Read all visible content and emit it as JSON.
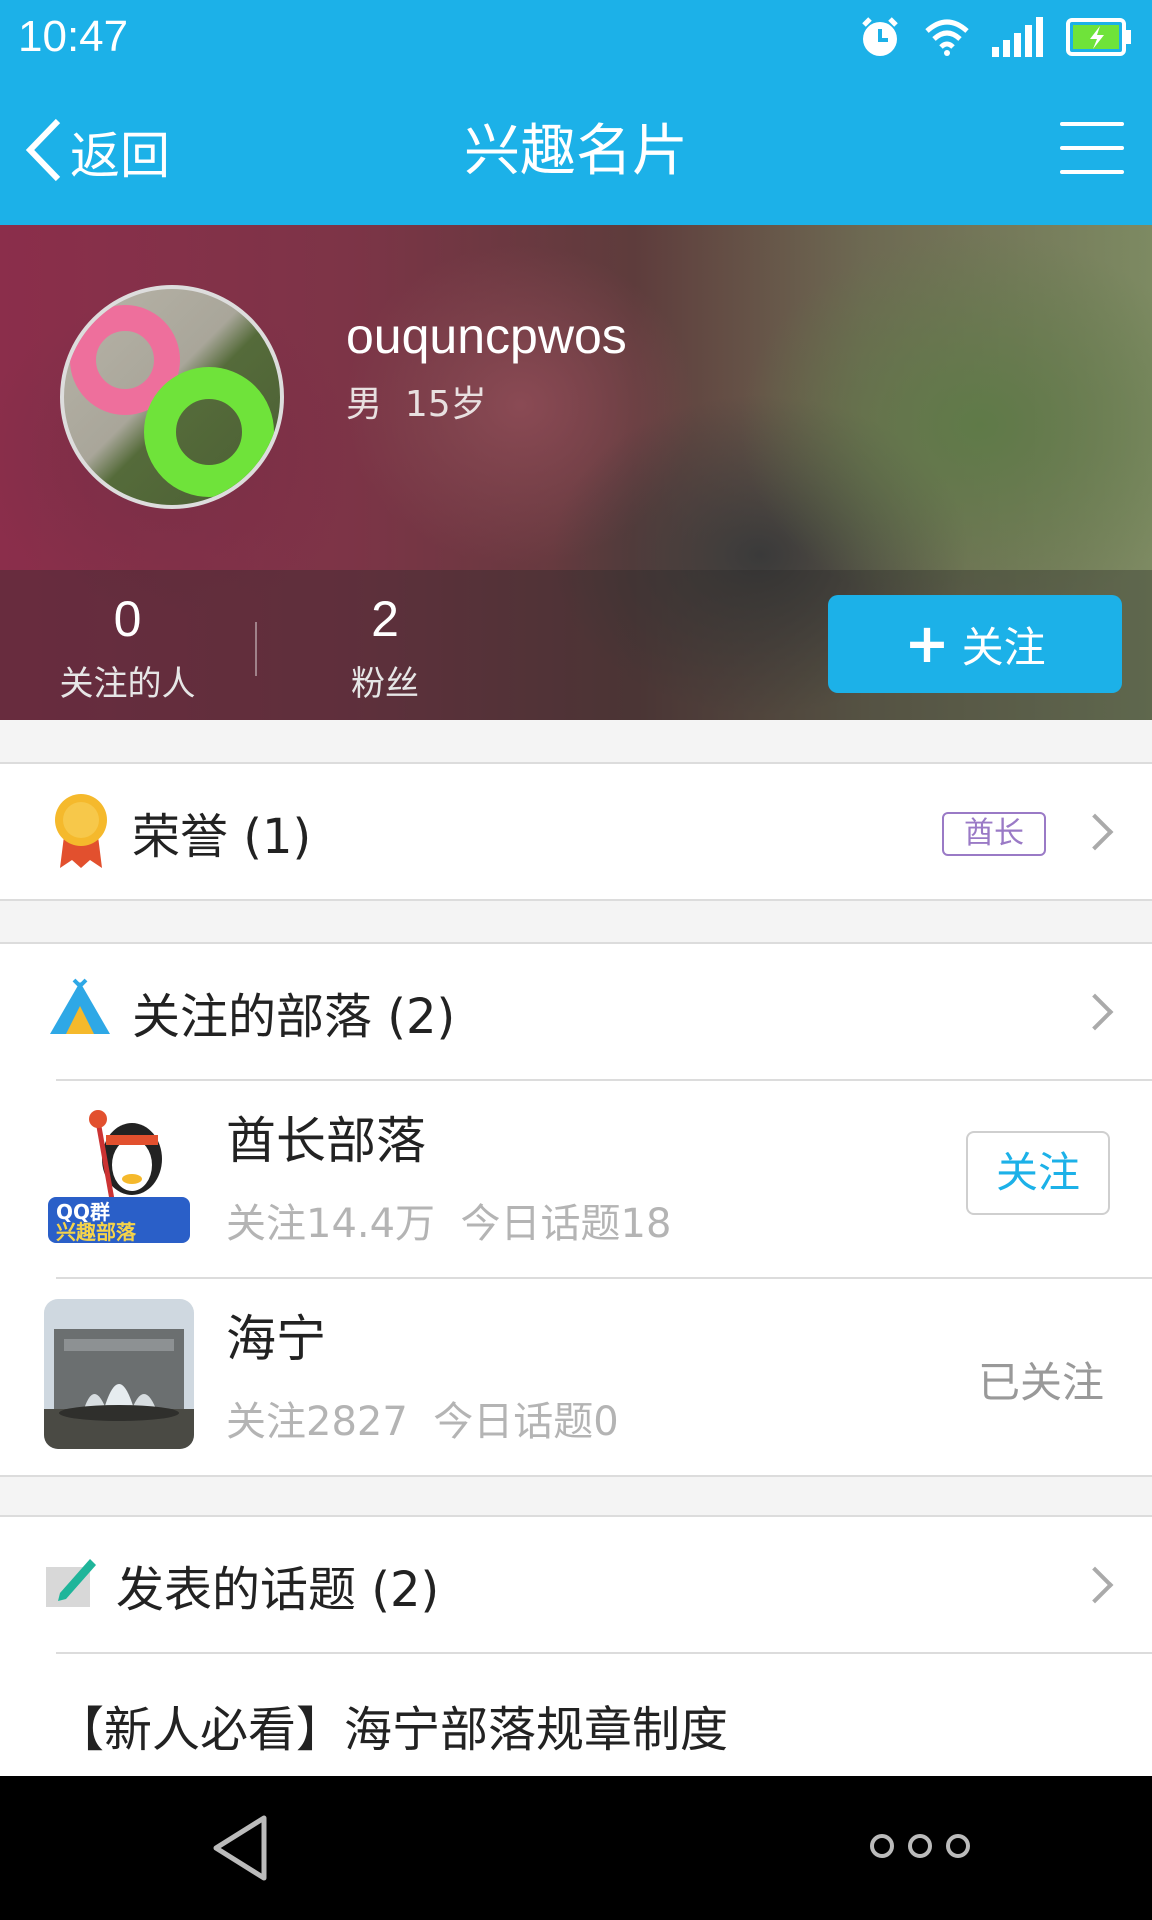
{
  "status_bar": {
    "time": "10:47"
  },
  "title_bar": {
    "back_label": "返回",
    "title": "兴趣名片"
  },
  "profile": {
    "username": "ouquncpwos",
    "gender": "男",
    "age": "15岁",
    "following_count": "0",
    "following_label": "关注的人",
    "fans_count": "2",
    "fans_label": "粉丝",
    "follow_button": "关注"
  },
  "honor": {
    "label": "荣誉 (1)",
    "tag": "酋长"
  },
  "tribes": {
    "label": "关注的部落 (2)",
    "items": [
      {
        "name": "酋长部落",
        "followers": "关注14.4万",
        "topics_today": "今日话题18",
        "action": "关注",
        "followed": false
      },
      {
        "name": "海宁",
        "followers": "关注2827",
        "topics_today": "今日话题0",
        "action": "已关注",
        "followed": true
      }
    ]
  },
  "posts": {
    "label": "发表的话题 (2)",
    "items": [
      {
        "title": "【新人必看】海宁部落规章制度"
      }
    ]
  },
  "colors": {
    "accent": "#1cb1e8",
    "tag_purple": "#9a7ac6",
    "muted_text": "#b4b4b4"
  },
  "icons": [
    "alarm-icon",
    "wifi-icon",
    "signal-icon",
    "battery-charging-icon",
    "back-chevron-icon",
    "menu-icon",
    "medal-icon",
    "tent-icon",
    "edit-icon",
    "nav-back-icon",
    "nav-more-icon"
  ]
}
